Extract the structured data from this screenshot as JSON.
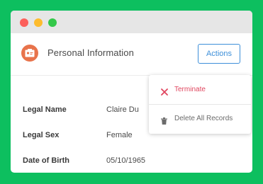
{
  "card": {
    "title": "Personal Information",
    "icon": "id-card-icon",
    "actions_label": "Actions"
  },
  "fields": [
    {
      "label": "Legal Name",
      "value": "Claire Du"
    },
    {
      "label": "Legal Sex",
      "value": "Female"
    },
    {
      "label": "Date of Birth",
      "value": "05/10/1965"
    }
  ],
  "menu": {
    "items": [
      {
        "label": "Terminate",
        "icon": "close-icon"
      },
      {
        "label": "Delete All Records",
        "icon": "trash-icon"
      }
    ]
  },
  "colors": {
    "background": "#0dbf5f",
    "accent": "#3d8fd9",
    "danger": "#e0465f",
    "icon_badge": "#e8734b"
  }
}
